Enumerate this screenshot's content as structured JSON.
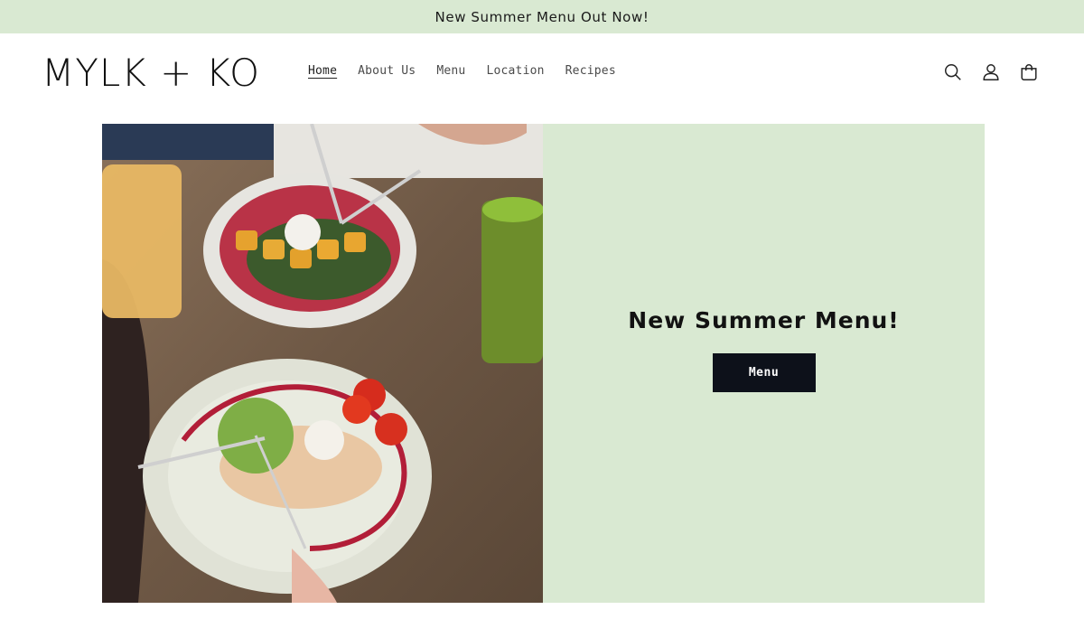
{
  "announcement": {
    "text": "New Summer Menu Out Now!"
  },
  "header": {
    "logo": "MYLK + KO",
    "nav": [
      {
        "label": "Home",
        "active": true
      },
      {
        "label": "About Us",
        "active": false
      },
      {
        "label": "Menu",
        "active": false
      },
      {
        "label": "Location",
        "active": false
      },
      {
        "label": "Recipes",
        "active": false
      }
    ],
    "icons": [
      "search-icon",
      "account-icon",
      "cart-icon"
    ]
  },
  "hero": {
    "title": "New Summer Menu!",
    "button_label": "Menu",
    "image": "food-photo"
  },
  "colors": {
    "accent_green": "#d9e9d2",
    "button_dark": "#0d111a"
  }
}
